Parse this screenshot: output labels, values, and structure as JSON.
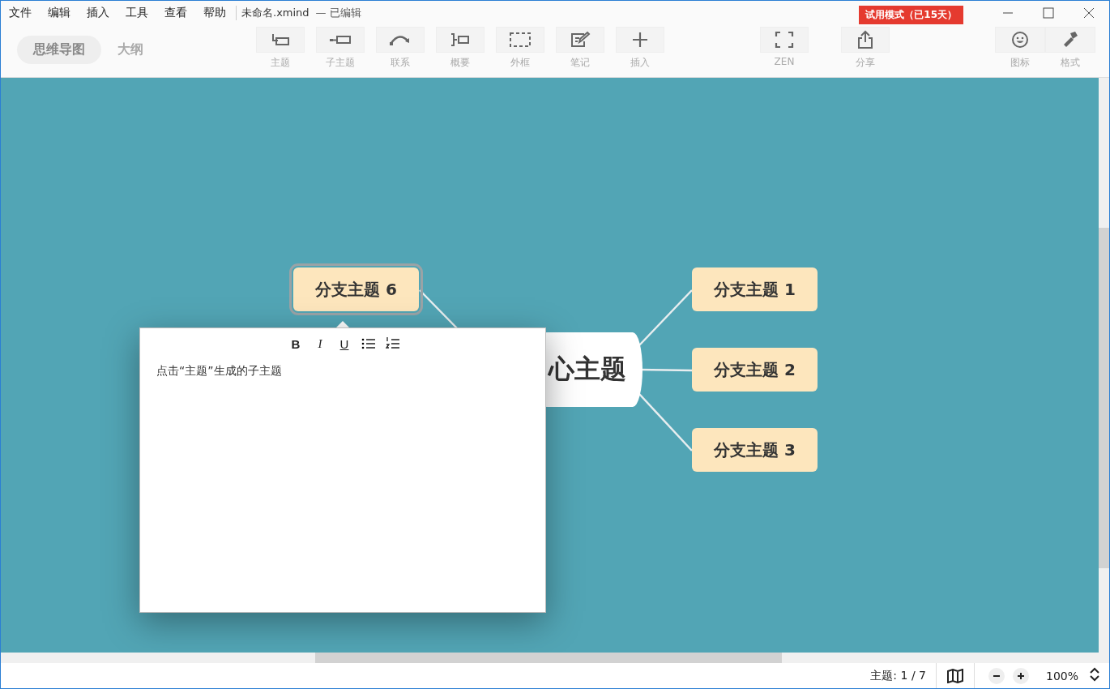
{
  "menu": [
    "文件",
    "编辑",
    "插入",
    "工具",
    "查看",
    "帮助"
  ],
  "window": {
    "title": "未命名.xmind",
    "status": "— 已编辑",
    "trial_badge": "试用模式（已15天）"
  },
  "view_tabs": [
    {
      "label": "思维导图",
      "selected": true
    },
    {
      "label": "大纲",
      "selected": false
    }
  ],
  "toolbar": [
    {
      "kind": "topic",
      "label": "主题"
    },
    {
      "kind": "subtopic",
      "label": "子主题"
    },
    {
      "kind": "relation",
      "label": "联系"
    },
    {
      "kind": "summary",
      "label": "概要"
    },
    {
      "kind": "boundary",
      "label": "外框"
    },
    {
      "kind": "note",
      "label": "笔记"
    },
    {
      "kind": "insert",
      "label": "插入"
    }
  ],
  "toolbar_middle": [
    {
      "kind": "zen",
      "label": "ZEN"
    },
    {
      "kind": "share",
      "label": "分享"
    }
  ],
  "toolbar_right": [
    {
      "kind": "icon",
      "label": "图标"
    },
    {
      "kind": "format",
      "label": "格式"
    }
  ],
  "map": {
    "central": "心主题",
    "left_branches": [
      {
        "label": "分支主题 6",
        "selected": true
      }
    ],
    "right_branches": [
      {
        "label": "分支主题 1",
        "selected": false
      },
      {
        "label": "分支主题 2",
        "selected": false
      },
      {
        "label": "分支主题 3",
        "selected": false
      }
    ]
  },
  "note": {
    "format_buttons": [
      {
        "kind": "bold",
        "label": "B"
      },
      {
        "kind": "italic",
        "label": "I"
      },
      {
        "kind": "underline",
        "label": "U"
      },
      {
        "kind": "bullets"
      },
      {
        "kind": "numbers"
      }
    ],
    "text": "点击“主题”生成的子主题"
  },
  "status_bar": {
    "topic_count": "主题: 1 / 7",
    "zoom": "100%"
  }
}
